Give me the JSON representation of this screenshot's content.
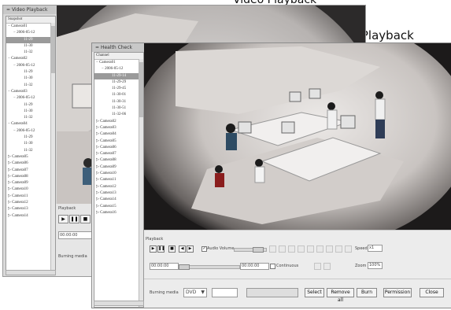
{
  "captions": {
    "video_playback": "Video Playback",
    "snapshot_playback": "Snapshot Playback"
  },
  "back_window": {
    "title": "Video Playback",
    "tree_header": "Snapshot",
    "tree": [
      {
        "label": "Camera01",
        "level": 0,
        "expanded": true
      },
      {
        "label": "2006-05-12",
        "level": 1,
        "expanded": true
      },
      {
        "label": "11-29",
        "level": 2,
        "selected": true
      },
      {
        "label": "11-30",
        "level": 2
      },
      {
        "label": "11-32",
        "level": 2
      },
      {
        "label": "Camera02",
        "level": 0,
        "expanded": true
      },
      {
        "label": "2006-05-12",
        "level": 1,
        "expanded": true
      },
      {
        "label": "11-29",
        "level": 2
      },
      {
        "label": "11-30",
        "level": 2
      },
      {
        "label": "11-32",
        "level": 2
      },
      {
        "label": "Camera03",
        "level": 0,
        "expanded": true
      },
      {
        "label": "2006-05-12",
        "level": 1,
        "expanded": true
      },
      {
        "label": "11-29",
        "level": 2
      },
      {
        "label": "11-30",
        "level": 2
      },
      {
        "label": "11-32",
        "level": 2
      },
      {
        "label": "Camera04",
        "level": 0,
        "expanded": true
      },
      {
        "label": "2006-05-12",
        "level": 1,
        "expanded": true
      },
      {
        "label": "11-29",
        "level": 2
      },
      {
        "label": "11-30",
        "level": 2
      },
      {
        "label": "11-32",
        "level": 2
      },
      {
        "label": "Camera05",
        "level": 0
      },
      {
        "label": "Camera06",
        "level": 0
      },
      {
        "label": "Camera07",
        "level": 0
      },
      {
        "label": "Camera08",
        "level": 0
      },
      {
        "label": "Camera09",
        "level": 0
      },
      {
        "label": "Camera10",
        "level": 0
      },
      {
        "label": "Camera11",
        "level": 0
      },
      {
        "label": "Camera12",
        "level": 0
      },
      {
        "label": "Camera13",
        "level": 0
      },
      {
        "label": "Camera14",
        "level": 0
      }
    ],
    "playback_label": "Playback",
    "time_value": "00:00:00",
    "burning_media_label": "Burning media"
  },
  "front_window": {
    "title": "Health Check",
    "tree_header": "Channel",
    "tree": [
      {
        "label": "Camera01",
        "level": 0,
        "expanded": true
      },
      {
        "label": "2006-05-12",
        "level": 1,
        "expanded": true
      },
      {
        "label": "11-29-14",
        "level": 2,
        "selected": true
      },
      {
        "label": "11-29-29",
        "level": 2
      },
      {
        "label": "11-29-45",
        "level": 2
      },
      {
        "label": "11-30-01",
        "level": 2
      },
      {
        "label": "11-30-31",
        "level": 2
      },
      {
        "label": "11-30-51",
        "level": 2
      },
      {
        "label": "11-32-06",
        "level": 2
      },
      {
        "label": "Camera02",
        "level": 0
      },
      {
        "label": "Camera03",
        "level": 0
      },
      {
        "label": "Camera04",
        "level": 0
      },
      {
        "label": "Camera05",
        "level": 0
      },
      {
        "label": "Camera06",
        "level": 0
      },
      {
        "label": "Camera07",
        "level": 0
      },
      {
        "label": "Camera08",
        "level": 0
      },
      {
        "label": "Camera09",
        "level": 0
      },
      {
        "label": "Camera10",
        "level": 0
      },
      {
        "label": "Camera11",
        "level": 0
      },
      {
        "label": "Camera12",
        "level": 0
      },
      {
        "label": "Camera13",
        "level": 0
      },
      {
        "label": "Camera14",
        "level": 0
      },
      {
        "label": "Camera15",
        "level": 0
      },
      {
        "label": "Camera16",
        "level": 0
      }
    ],
    "playback_label": "Playback",
    "audio_volume_label": "Audio Volume",
    "speed_label": "Speed",
    "speed_value": "x1",
    "time_start": "00:00:00",
    "time_end": "00:00:00",
    "continuous_label": "Continuous",
    "zoom_label": "Zoom",
    "zoom_value": "100%",
    "burning_media_label": "Burning media",
    "media_select_value": "DVD",
    "buttons": {
      "select": "Select",
      "remove_all": "Remove all",
      "burn": "Burn",
      "permission": "Permission",
      "close": "Close"
    }
  },
  "colors": {
    "selection": "#9a9a9a",
    "window_bg": "#ececec",
    "panel_border": "#8c8c8c"
  },
  "icons": [
    "play-icon",
    "pause-icon",
    "stop-icon",
    "prev-frame-icon",
    "next-frame-icon",
    "expand-icon",
    "collapse-icon",
    "dropdown-arrow-icon"
  ]
}
